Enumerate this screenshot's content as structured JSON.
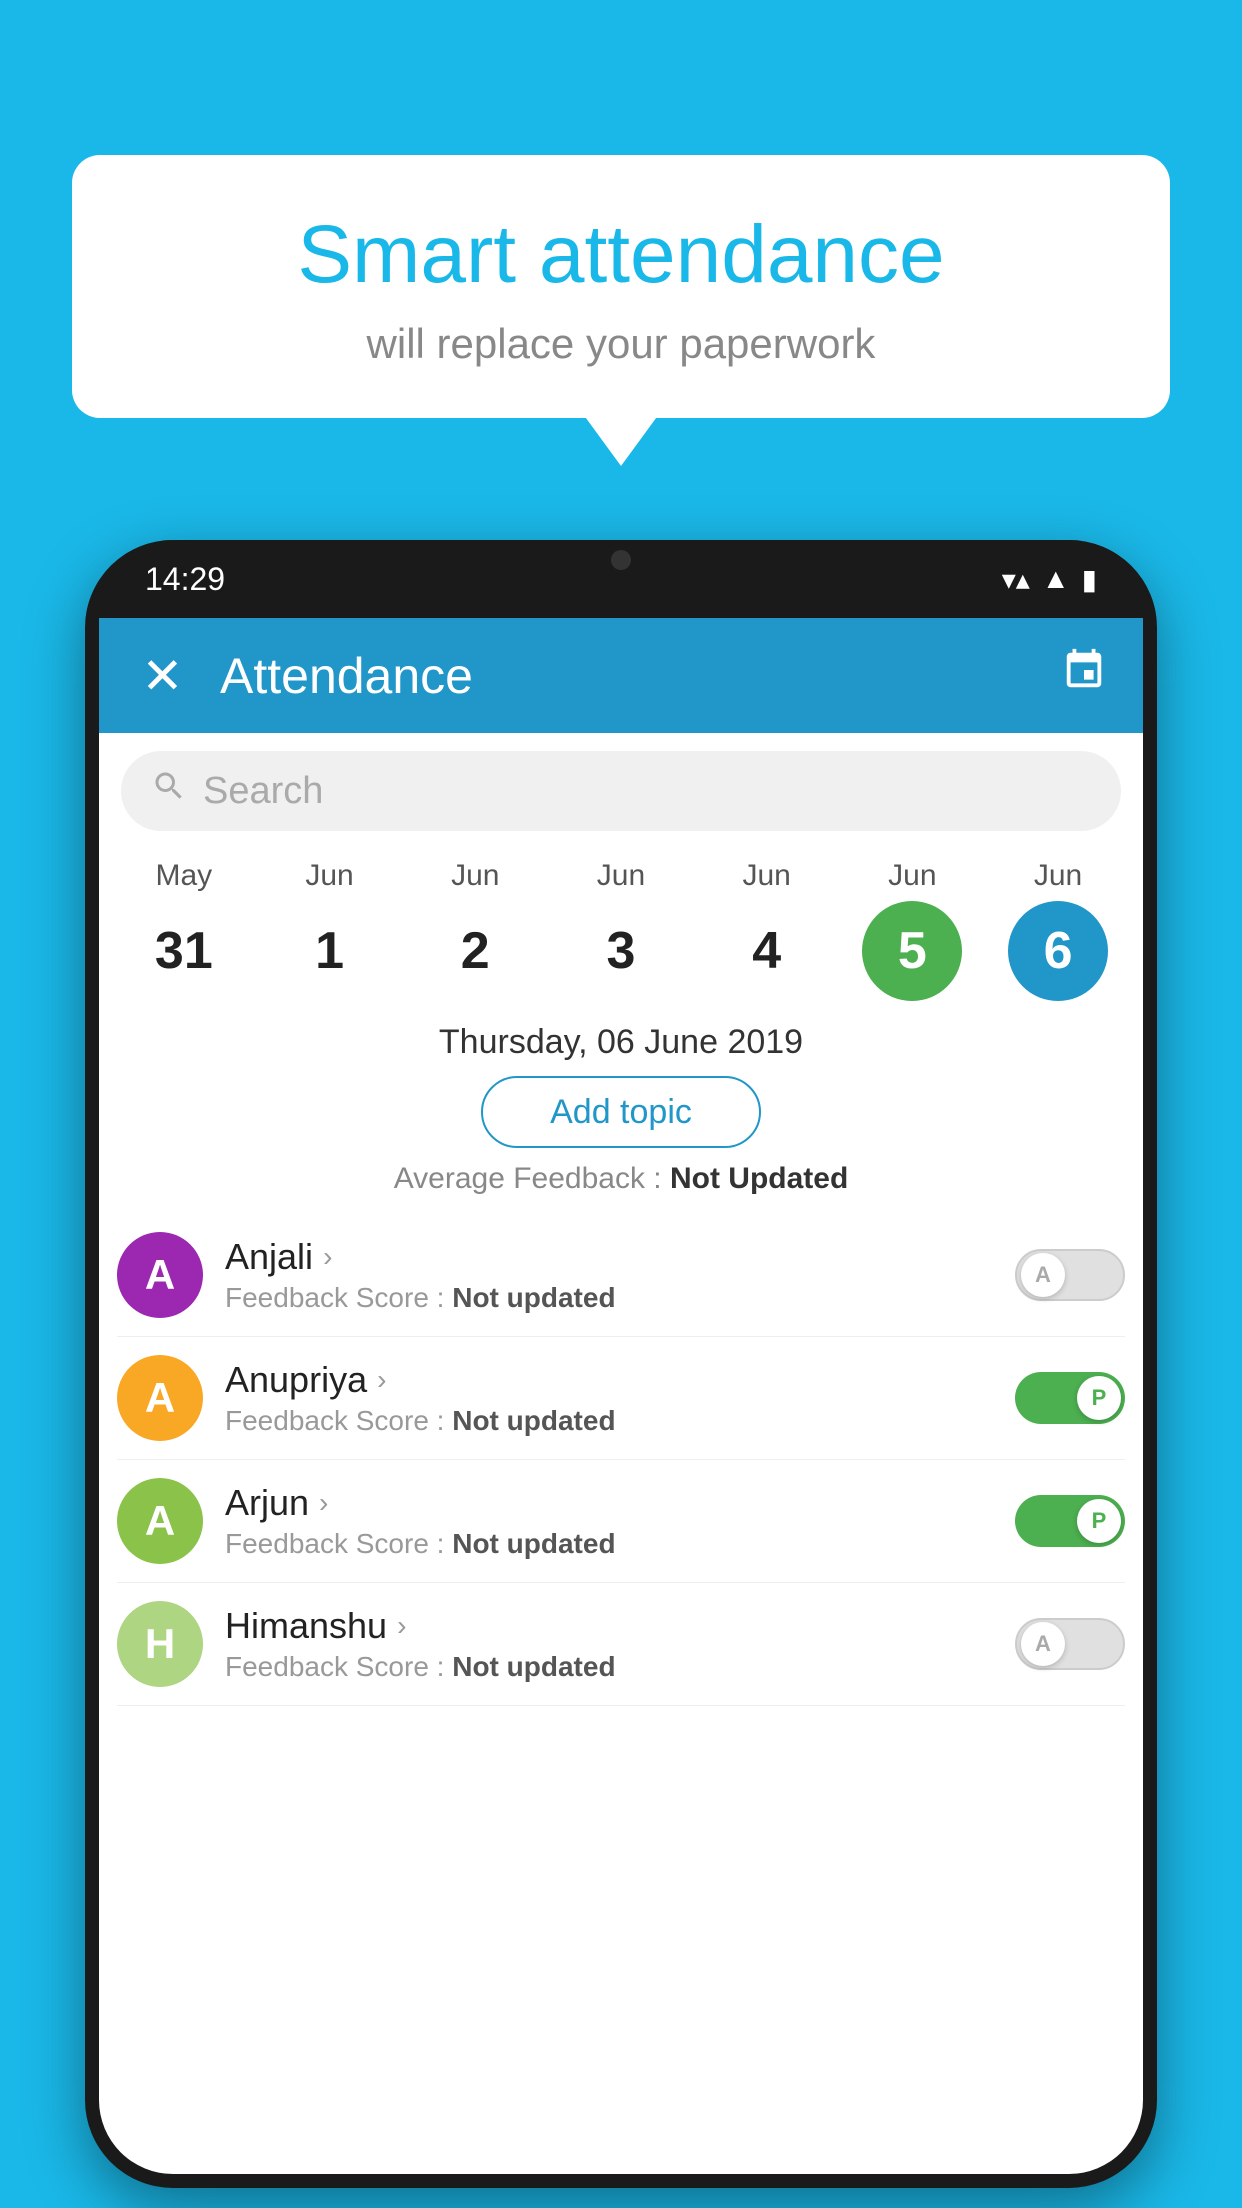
{
  "background": {
    "color": "#1ab8e8"
  },
  "speech_bubble": {
    "title": "Smart attendance",
    "subtitle": "will replace your paperwork"
  },
  "phone": {
    "status_bar": {
      "time": "14:29",
      "wifi": "▼▲",
      "battery": "▮"
    },
    "app_bar": {
      "title": "Attendance",
      "close_label": "✕",
      "calendar_icon": "📅"
    },
    "search": {
      "placeholder": "Search"
    },
    "calendar": {
      "days": [
        {
          "month": "May",
          "num": "31",
          "state": "normal"
        },
        {
          "month": "Jun",
          "num": "1",
          "state": "normal"
        },
        {
          "month": "Jun",
          "num": "2",
          "state": "normal"
        },
        {
          "month": "Jun",
          "num": "3",
          "state": "normal"
        },
        {
          "month": "Jun",
          "num": "4",
          "state": "normal"
        },
        {
          "month": "Jun",
          "num": "5",
          "state": "today"
        },
        {
          "month": "Jun",
          "num": "6",
          "state": "selected"
        }
      ]
    },
    "selected_date": "Thursday, 06 June 2019",
    "add_topic_label": "Add topic",
    "average_feedback_label": "Average Feedback : ",
    "average_feedback_value": "Not Updated",
    "students": [
      {
        "name": "Anjali",
        "avatar_letter": "A",
        "avatar_color": "#9c27b0",
        "feedback_label": "Feedback Score : ",
        "feedback_value": "Not updated",
        "toggle_state": "off",
        "toggle_letter": "A"
      },
      {
        "name": "Anupriya",
        "avatar_letter": "A",
        "avatar_color": "#f9a825",
        "feedback_label": "Feedback Score : ",
        "feedback_value": "Not updated",
        "toggle_state": "on",
        "toggle_letter": "P"
      },
      {
        "name": "Arjun",
        "avatar_letter": "A",
        "avatar_color": "#8bc34a",
        "feedback_label": "Feedback Score : ",
        "feedback_value": "Not updated",
        "toggle_state": "on",
        "toggle_letter": "P"
      },
      {
        "name": "Himanshu",
        "avatar_letter": "H",
        "avatar_color": "#aed581",
        "feedback_label": "Feedback Score : ",
        "feedback_value": "Not updated",
        "toggle_state": "off",
        "toggle_letter": "A"
      }
    ]
  }
}
